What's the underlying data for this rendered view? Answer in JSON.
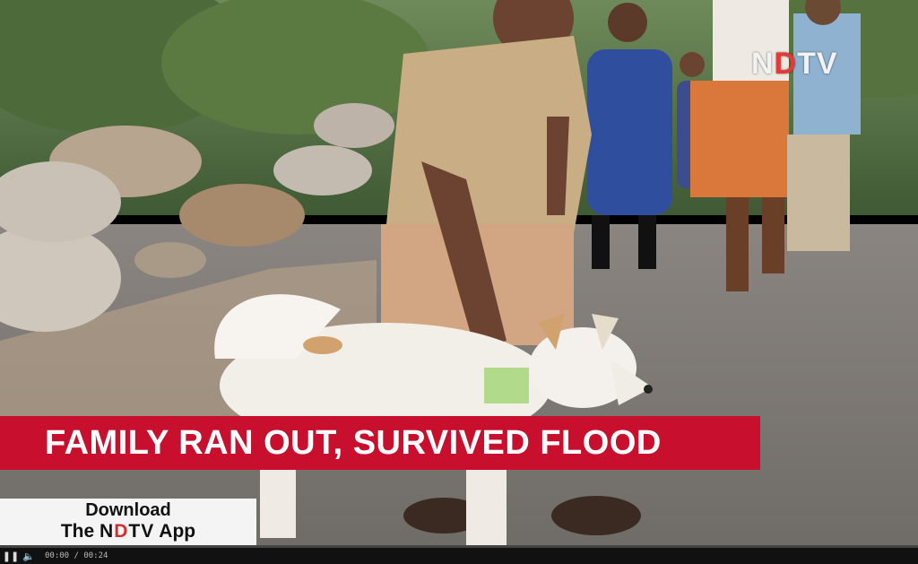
{
  "broadcaster": {
    "logo_prefix": "N",
    "logo_highlight": "D",
    "logo_suffix": "TV"
  },
  "lower_third": {
    "headline": "FAMILY RAN OUT, SURVIVED FLOOD"
  },
  "promo": {
    "line1": "Download",
    "line2_prefix": "The",
    "line2_brand_a": "N",
    "line2_brand_r": "D",
    "line2_brand_b": "TV",
    "line2_suffix": "App"
  },
  "player": {
    "time": "00:00 / 00:24",
    "progress": 0.0
  },
  "colors": {
    "headline_bg": "#c8102e",
    "brand_red": "#e53935"
  }
}
